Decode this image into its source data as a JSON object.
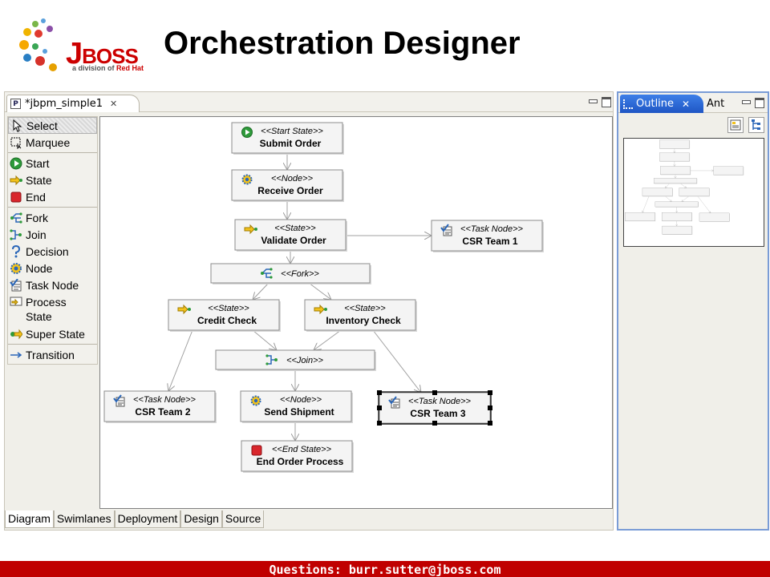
{
  "header": {
    "title": "Orchestration Designer",
    "logo_word_j": "J",
    "logo_word_rest": "BOSS",
    "logo_sub_prefix": "a division of ",
    "logo_sub_brand": "Red Hat"
  },
  "editor": {
    "tab_label": "*jbpm_simple1",
    "tab_icon_letter": "P",
    "palette": [
      {
        "id": "select",
        "label": "Select",
        "icon": "cursor-icon"
      },
      {
        "id": "marquee",
        "label": "Marquee",
        "icon": "marquee-icon"
      },
      {
        "id": "start",
        "label": "Start",
        "icon": "start-icon"
      },
      {
        "id": "state",
        "label": "State",
        "icon": "state-icon"
      },
      {
        "id": "end",
        "label": "End",
        "icon": "end-icon"
      },
      {
        "id": "fork",
        "label": "Fork",
        "icon": "fork-icon"
      },
      {
        "id": "join",
        "label": "Join",
        "icon": "join-icon"
      },
      {
        "id": "decision",
        "label": "Decision",
        "icon": "decision-icon"
      },
      {
        "id": "node",
        "label": "Node",
        "icon": "node-gear-icon"
      },
      {
        "id": "task-node",
        "label": "Task Node",
        "icon": "task-node-icon"
      },
      {
        "id": "process-state",
        "label": "Process State",
        "icon": "process-state-icon"
      },
      {
        "id": "super-state",
        "label": "Super State",
        "icon": "super-state-icon"
      },
      {
        "id": "transition",
        "label": "Transition",
        "icon": "transition-arrow-icon"
      }
    ],
    "bottom_tabs": [
      "Diagram",
      "Swimlanes",
      "Deployment",
      "Design",
      "Source"
    ],
    "active_bottom_tab": "Diagram"
  },
  "diagram": {
    "nodes": [
      {
        "id": "submit-order",
        "stereotype": "<<Start State>>",
        "label": "Submit Order",
        "icon": "start-icon"
      },
      {
        "id": "receive-order",
        "stereotype": "<<Node>>",
        "label": "Receive Order",
        "icon": "node-gear-icon"
      },
      {
        "id": "validate-order",
        "stereotype": "<<State>>",
        "label": "Validate Order",
        "icon": "state-icon"
      },
      {
        "id": "csr-team-1",
        "stereotype": "<<Task Node>>",
        "label": "CSR Team 1",
        "icon": "task-node-icon"
      },
      {
        "id": "fork",
        "stereotype": "<<Fork>>",
        "label": "",
        "icon": "fork-icon"
      },
      {
        "id": "credit-check",
        "stereotype": "<<State>>",
        "label": "Credit Check",
        "icon": "state-icon"
      },
      {
        "id": "inventory-check",
        "stereotype": "<<State>>",
        "label": "Inventory Check",
        "icon": "state-icon"
      },
      {
        "id": "join",
        "stereotype": "<<Join>>",
        "label": "",
        "icon": "join-icon"
      },
      {
        "id": "csr-team-2",
        "stereotype": "<<Task Node>>",
        "label": "CSR Team 2",
        "icon": "task-node-icon"
      },
      {
        "id": "send-shipment",
        "stereotype": "<<Node>>",
        "label": "Send Shipment",
        "icon": "node-gear-icon"
      },
      {
        "id": "csr-team-3",
        "stereotype": "<<Task Node>>",
        "label": "CSR Team 3",
        "icon": "task-node-icon",
        "selected": true
      },
      {
        "id": "end-order-process",
        "stereotype": "<<End State>>",
        "label": "End Order Process",
        "icon": "end-icon"
      }
    ],
    "edges": [
      [
        "submit-order",
        "receive-order"
      ],
      [
        "receive-order",
        "validate-order"
      ],
      [
        "validate-order",
        "csr-team-1"
      ],
      [
        "validate-order",
        "fork"
      ],
      [
        "fork",
        "credit-check"
      ],
      [
        "fork",
        "inventory-check"
      ],
      [
        "credit-check",
        "join"
      ],
      [
        "inventory-check",
        "join"
      ],
      [
        "credit-check",
        "csr-team-2"
      ],
      [
        "inventory-check",
        "csr-team-3"
      ],
      [
        "join",
        "send-shipment"
      ],
      [
        "send-shipment",
        "end-order-process"
      ]
    ]
  },
  "outline": {
    "tab_label": "Outline",
    "other_tab_label": "Ant"
  },
  "footer": {
    "text": "Questions: burr.sutter@jboss.com"
  },
  "colors": {
    "brand_red": "#cc0000",
    "footer_red": "#c00000",
    "outline_tab_blue": "#2c6be0",
    "node_border": "#8c8c8c"
  }
}
